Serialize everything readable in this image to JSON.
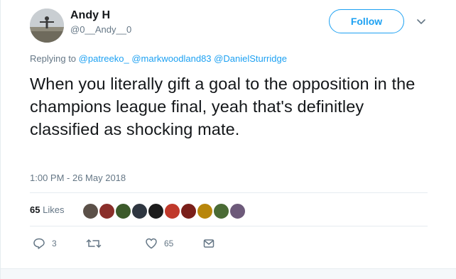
{
  "user": {
    "display_name": "Andy H",
    "handle": "@0__Andy__0"
  },
  "follow_label": "Follow",
  "reply": {
    "prefix": "Replying to",
    "mentions": [
      "@patreeko_",
      "@markwoodland83",
      "@DanielSturridge"
    ]
  },
  "tweet": {
    "text": "When you literally gift a goal to the opposition in the champions league final, yeah that's definitley classified as shocking mate.",
    "timestamp": "1:00 PM - 26 May 2018"
  },
  "likes": {
    "count": "65",
    "label": "Likes",
    "liker_avatars": [
      "#5b5048",
      "#8a2e2a",
      "#3c5a2a",
      "#2e3640",
      "#1c1c1c",
      "#c0392b",
      "#7a1f1a",
      "#b8860b",
      "#4a6b35",
      "#6d5a7a"
    ]
  },
  "actions": {
    "reply_count": "3",
    "retweet_count": "",
    "like_count": "65"
  },
  "icons": {
    "more": "chevron-down-icon",
    "reply": "reply-icon",
    "retweet": "retweet-icon",
    "like": "heart-icon",
    "message": "envelope-icon"
  },
  "colors": {
    "accent": "#1da1f2",
    "muted": "#657786",
    "text": "#14171a",
    "divider": "#e6ecf0"
  }
}
